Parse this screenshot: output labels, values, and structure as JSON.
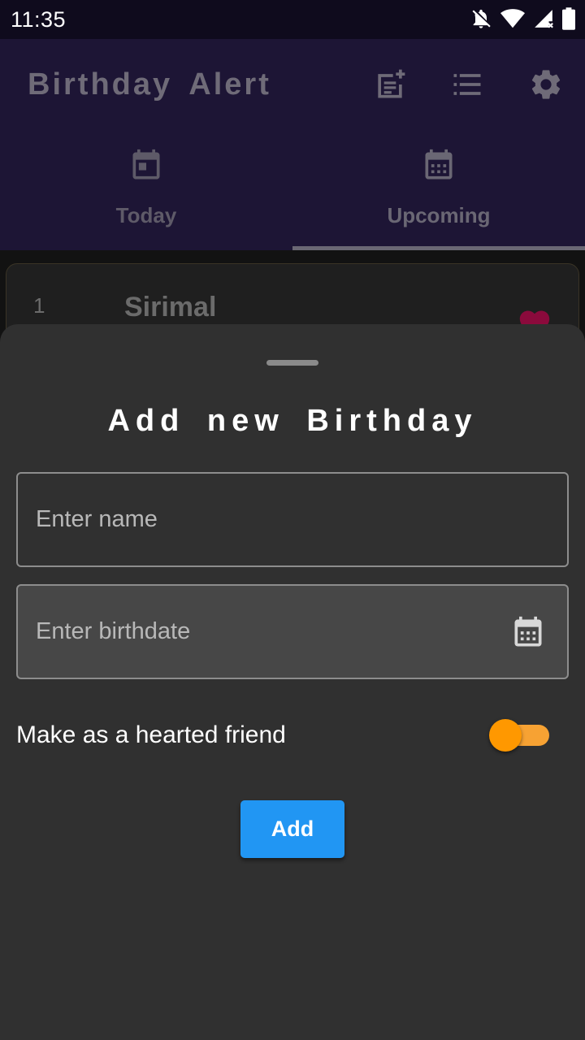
{
  "status_bar": {
    "time": "11:35",
    "icons": [
      "notifications-off-icon",
      "wifi-icon",
      "signal-icon",
      "battery-icon"
    ]
  },
  "app_bar": {
    "title": "Birthday  Alert",
    "actions": [
      "add-note-icon",
      "list-icon",
      "settings-icon"
    ]
  },
  "tabs": [
    {
      "label": "Today",
      "icon": "calendar-today-icon",
      "selected": false
    },
    {
      "label": "Upcoming",
      "icon": "calendar-month-icon",
      "selected": true
    }
  ],
  "list": {
    "items": [
      {
        "index": "1",
        "name": "Sirimal",
        "hearted": true
      }
    ]
  },
  "sheet": {
    "title": "Add  new  Birthday",
    "name_placeholder": "Enter name",
    "name_value": "",
    "birthdate_placeholder": "Enter birthdate",
    "birthdate_value": "",
    "hearted_label": "Make as a hearted friend",
    "hearted_on": true,
    "add_label": "Add"
  },
  "colors": {
    "app_bar": "#1d1535",
    "sheet": "#303030",
    "accent_orange": "#ff9800",
    "button_blue": "#2196f3",
    "heart": "#8b0a3c"
  }
}
